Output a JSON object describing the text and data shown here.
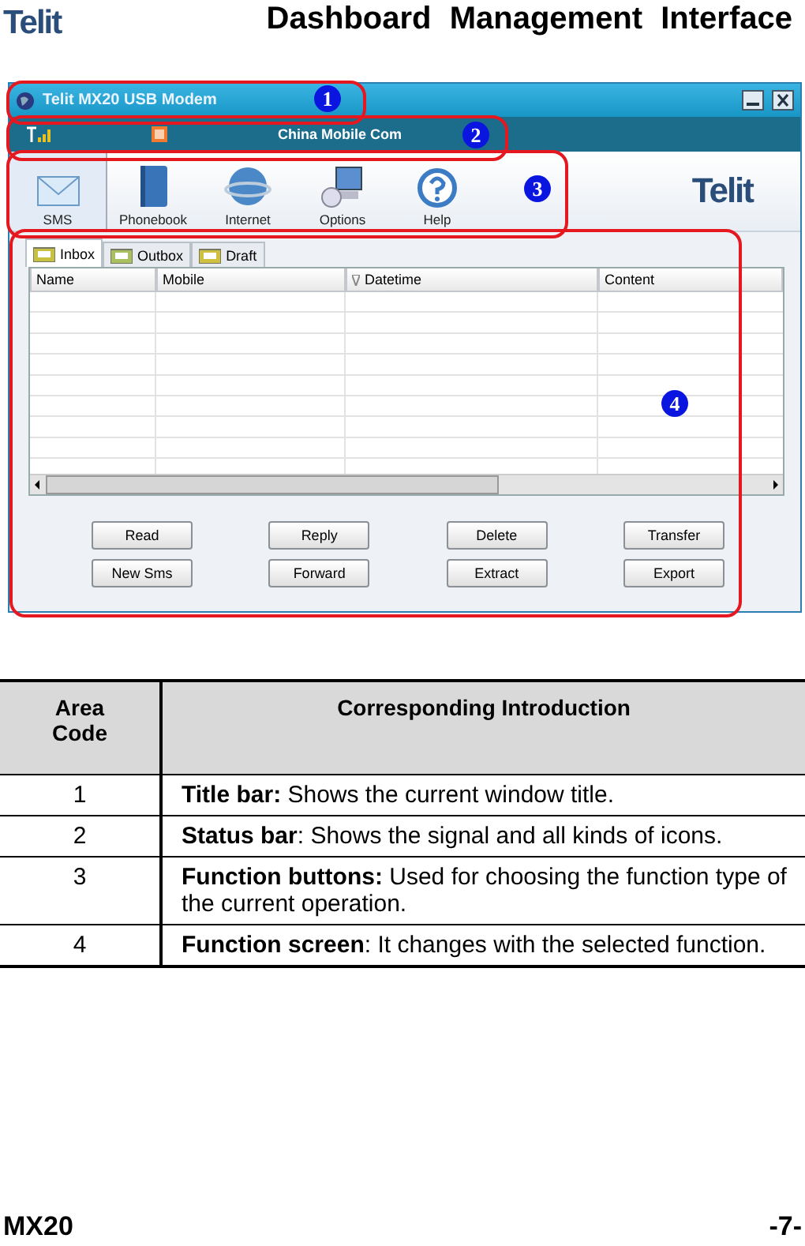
{
  "header": {
    "logo": "Telit",
    "title": "Dashboard Management Interface"
  },
  "window": {
    "title": "Telit MX20 USB Modem",
    "status_bar": {
      "operator": "China Mobile Com"
    },
    "toolbar": [
      {
        "kind": "sms",
        "label": "SMS",
        "selected": true
      },
      {
        "kind": "phonebook",
        "label": "Phonebook",
        "selected": false
      },
      {
        "kind": "internet",
        "label": "Internet",
        "selected": false
      },
      {
        "kind": "options",
        "label": "Options",
        "selected": false
      },
      {
        "kind": "help",
        "label": "Help",
        "selected": false
      }
    ],
    "brand": "Telit",
    "tabs": [
      {
        "kind": "inbox",
        "label": "Inbox",
        "selected": true
      },
      {
        "kind": "outbox",
        "label": "Outbox",
        "selected": false
      },
      {
        "kind": "draft",
        "label": "Draft",
        "selected": false
      }
    ],
    "columns": [
      {
        "label": "Name",
        "sorted": false
      },
      {
        "label": "Mobile",
        "sorted": false
      },
      {
        "label": "Datetime",
        "sorted": true
      },
      {
        "label": "Content",
        "sorted": false
      }
    ],
    "buttons": [
      "Read",
      "Reply",
      "Delete",
      "Transfer",
      "New Sms",
      "Forward",
      "Extract",
      "Export"
    ]
  },
  "callouts": [
    "1",
    "2",
    "3",
    "4"
  ],
  "table": {
    "columns": [
      "Area Code",
      "Corresponding Introduction"
    ],
    "rows": [
      {
        "code": "1",
        "text": "**Title bar:** Shows the current window title."
      },
      {
        "code": "2",
        "text": "**Status bar**: Shows the signal and all kinds of icons."
      },
      {
        "code": "3",
        "text": "**Function buttons:** Used for choosing the function type of the current operation."
      },
      {
        "code": "4",
        "text": "**Function screen**: It changes with the selected function."
      }
    ]
  },
  "footer": {
    "model": "MX20",
    "page": "-7-"
  }
}
